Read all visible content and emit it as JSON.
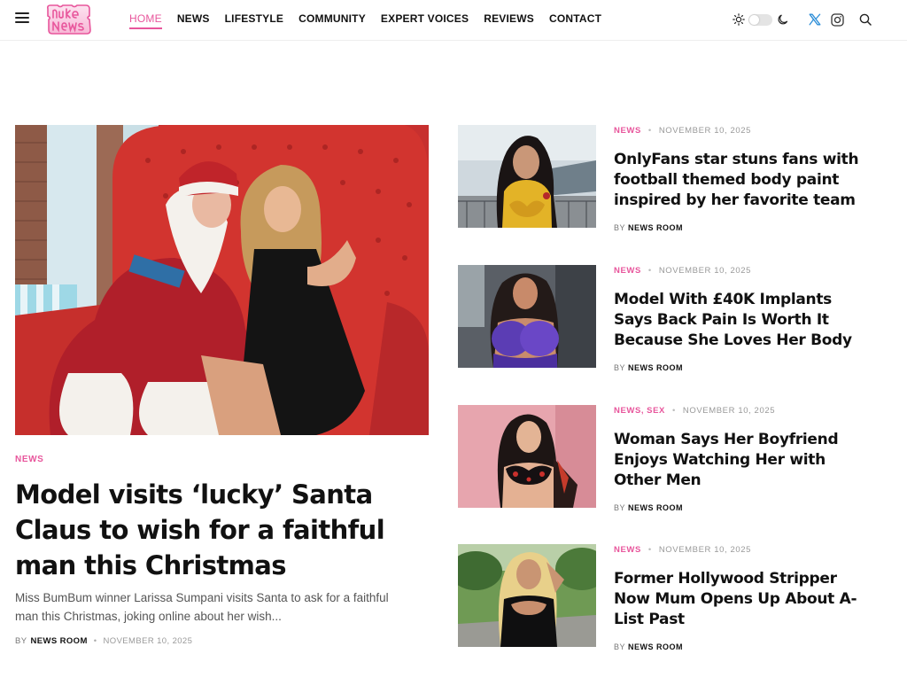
{
  "header": {
    "nav": [
      {
        "label": "HOME",
        "active": true
      },
      {
        "label": "NEWS",
        "active": false
      },
      {
        "label": "LIFESTYLE",
        "active": false
      },
      {
        "label": "COMMUNITY",
        "active": false
      },
      {
        "label": "EXPERT VOICES",
        "active": false
      },
      {
        "label": "REVIEWS",
        "active": false
      },
      {
        "label": "CONTACT",
        "active": false
      }
    ],
    "accent_color": "#e8569c",
    "icons": [
      "menu-icon",
      "sun-icon",
      "moon-icon",
      "x-twitter-icon",
      "instagram-icon",
      "search-icon"
    ]
  },
  "featured": {
    "category": "NEWS",
    "title": "Model visits ‘lucky’ Santa Claus to wish for a faithful man this Christmas",
    "excerpt": "Miss BumBum winner Larissa Sumpani visits Santa to ask for a faithful man this Christmas, joking online about her wish...",
    "by": "BY",
    "author": "NEWS ROOM",
    "date": "NOVEMBER 10, 2025"
  },
  "articles": [
    {
      "categories": [
        "NEWS"
      ],
      "date": "NOVEMBER 10, 2025",
      "title": "OnlyFans star stuns fans with football themed body paint inspired by her favorite team",
      "by": "BY",
      "author": "NEWS ROOM"
    },
    {
      "categories": [
        "NEWS"
      ],
      "date": "NOVEMBER 10, 2025",
      "title": "Model With £40K Implants Says Back Pain Is Worth It Because She Loves Her Body",
      "by": "BY",
      "author": "NEWS ROOM"
    },
    {
      "categories": [
        "NEWS",
        "SEX"
      ],
      "date": "NOVEMBER 10, 2025",
      "title": "Woman Says Her Boyfriend Enjoys Watching Her with Other Men",
      "by": "BY",
      "author": "NEWS ROOM"
    },
    {
      "categories": [
        "NEWS"
      ],
      "date": "NOVEMBER 10, 2025",
      "title": "Former Hollywood Stripper Now Mum Opens Up About A-List Past",
      "by": "BY",
      "author": "NEWS ROOM"
    }
  ]
}
